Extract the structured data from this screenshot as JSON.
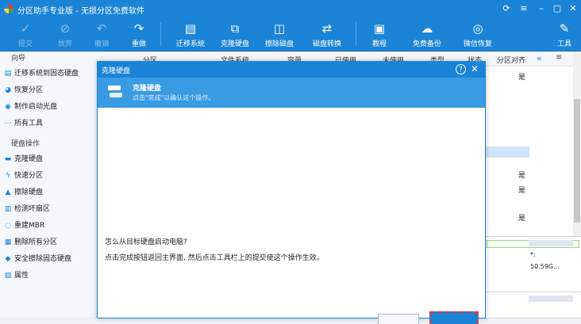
{
  "window": {
    "title": "分区助手专业版 - 无损分区免费软件"
  },
  "toolbar": {
    "items": [
      {
        "label": "提交",
        "icon": "check-icon"
      },
      {
        "label": "放弃",
        "icon": "cancel-icon"
      },
      {
        "label": "撤销",
        "icon": "undo-icon"
      },
      {
        "label": "重做",
        "icon": "redo-icon"
      },
      {
        "label": "迁移系统",
        "icon": "migrate-os-icon"
      },
      {
        "label": "克隆硬盘",
        "icon": "clone-disk-icon"
      },
      {
        "label": "擦除磁盘",
        "icon": "wipe-disk-icon"
      },
      {
        "label": "磁盘转换",
        "icon": "disk-convert-icon"
      },
      {
        "label": "教程",
        "icon": "tutorial-icon"
      },
      {
        "label": "免费备份",
        "icon": "free-backup-icon"
      },
      {
        "label": "微信恢复",
        "icon": "wechat-recovery-icon"
      },
      {
        "label": "工具",
        "icon": "tools-icon"
      }
    ]
  },
  "sidebar": {
    "wizard_heading": "向导",
    "wizard_items": [
      {
        "label": "迁移系统到固态硬盘",
        "icon": "migrate-icon"
      },
      {
        "label": "恢复分区",
        "icon": "recover-partition-icon"
      },
      {
        "label": "制作启动光盘",
        "icon": "boot-disc-icon"
      },
      {
        "label": "所有工具",
        "icon": "all-tools-icon"
      }
    ],
    "disk_heading": "硬盘操作",
    "disk_items": [
      {
        "label": "克隆硬盘",
        "icon": "clone-icon"
      },
      {
        "label": "快速分区",
        "icon": "quick-partition-icon"
      },
      {
        "label": "擦除硬盘",
        "icon": "wipe-icon"
      },
      {
        "label": "检测坏扇区",
        "icon": "bad-sector-icon"
      },
      {
        "label": "重建MBR",
        "icon": "rebuild-mbr-icon"
      },
      {
        "label": "删除所有分区",
        "icon": "delete-partitions-icon"
      },
      {
        "label": "安全擦除固态硬盘",
        "icon": "secure-erase-icon"
      },
      {
        "label": "属性",
        "icon": "properties-icon"
      }
    ]
  },
  "table": {
    "columns": [
      "分区",
      "文件系统",
      "容量",
      "已使用",
      "未使用",
      "类型",
      "状态",
      "分区对齐"
    ],
    "align_values": [
      "是",
      "是",
      "是",
      "是"
    ]
  },
  "disk_panel": {
    "label": "*:",
    "size": "50.59G..."
  },
  "dialog": {
    "title": "克隆硬盘",
    "banner_title": "克隆硬盘",
    "banner_subtitle": "点击\"完成\"以确认这个操作。",
    "question": "怎么从目标硬盘启动电脑?",
    "answer": "点击完成按钮返回主界面, 然后点击工具栏上的提交使这个操作生效。"
  }
}
